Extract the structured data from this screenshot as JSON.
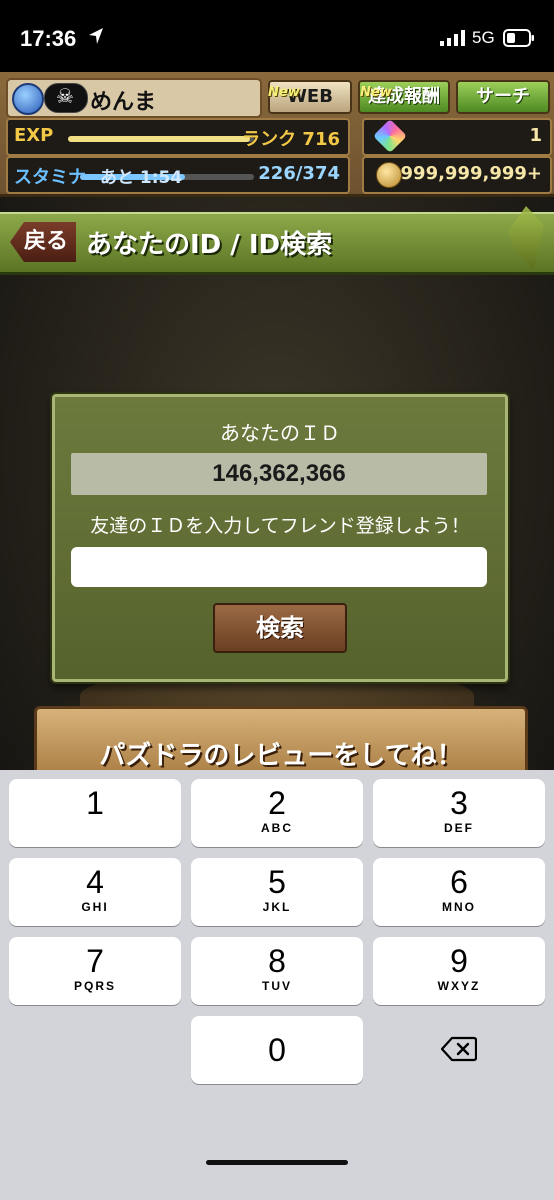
{
  "status_bar": {
    "time": "17:36",
    "network": "5G",
    "icons": [
      "location-arrow-icon",
      "signal-bars-icon",
      "battery-icon"
    ]
  },
  "hud": {
    "player_name": "めんま",
    "web_label": "WEB",
    "achievements_label": "達成報酬",
    "search_label": "サーチ",
    "new_tag": "New",
    "exp_label": "EXP",
    "rank_text": "ランク 716",
    "stamina_label": "スタミナ",
    "stamina_timer": "あと 1:54",
    "stamina_value": "226/374",
    "stamina_fraction": 0.604,
    "exp_fraction": 0.98,
    "magic_stones": "1",
    "coins": "999,999,999+"
  },
  "title_bar": {
    "back_label": "戻る",
    "title": "あなたのID / ID検索"
  },
  "id_panel": {
    "your_id_label": "あなたのＩＤ",
    "your_id_value": "146,362,366",
    "prompt": "友達のＩＤを入力してフレンド登録しよう！",
    "input_value": "",
    "search_button": "検索"
  },
  "review_banner": {
    "text": "パズドラのレビューをしてね！"
  },
  "keypad": {
    "keys": [
      {
        "digit": "1",
        "letters": ""
      },
      {
        "digit": "2",
        "letters": "ABC"
      },
      {
        "digit": "3",
        "letters": "DEF"
      },
      {
        "digit": "4",
        "letters": "GHI"
      },
      {
        "digit": "5",
        "letters": "JKL"
      },
      {
        "digit": "6",
        "letters": "MNO"
      },
      {
        "digit": "7",
        "letters": "PQRS"
      },
      {
        "digit": "8",
        "letters": "TUV"
      },
      {
        "digit": "9",
        "letters": "WXYZ"
      },
      {
        "digit": "0",
        "letters": ""
      }
    ],
    "delete_icon": "backspace-icon"
  },
  "colors": {
    "panel_green": "#6c7a3e",
    "title_green": "#8ea94a",
    "gold_text": "#f2c846",
    "keypad_bg": "#d2d4d9"
  }
}
